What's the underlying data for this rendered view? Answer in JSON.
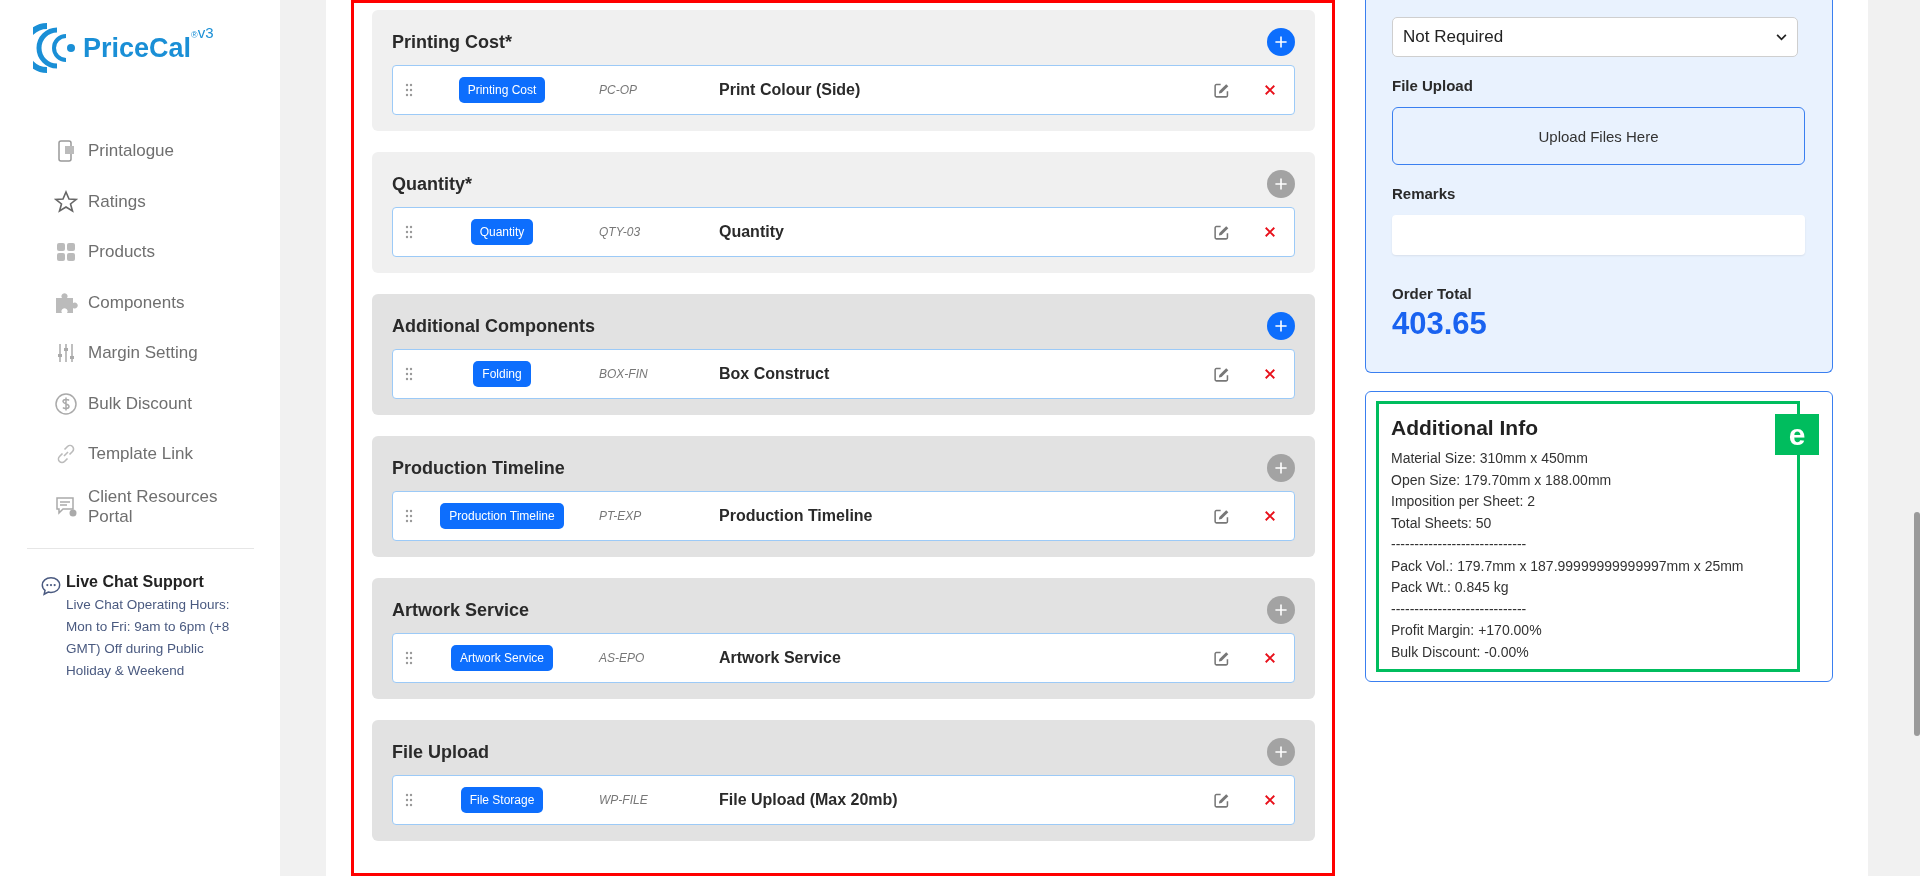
{
  "logo": {
    "name": "PriceCal",
    "mark": "®",
    "version": "v3"
  },
  "sidebar": {
    "items": [
      {
        "label": "Printalogue"
      },
      {
        "label": "Ratings"
      },
      {
        "label": "Products"
      },
      {
        "label": "Components"
      },
      {
        "label": "Margin Setting"
      },
      {
        "label": "Bulk Discount"
      },
      {
        "label": "Template Link"
      },
      {
        "label": "Client Resources Portal"
      }
    ],
    "support": {
      "title": "Live Chat Support",
      "text": "Live Chat Operating Hours: Mon to Fri: 9am to 6pm (+8 GMT) Off during Public Holiday & Weekend"
    }
  },
  "sections": [
    {
      "title": "Printing Cost*",
      "required": true,
      "add_disabled": false,
      "item": {
        "tag": "Printing Cost",
        "code": "PC-OP",
        "name": "Print Colour (Side)"
      }
    },
    {
      "title": "Quantity*",
      "required": true,
      "add_disabled": true,
      "item": {
        "tag": "Quantity",
        "code": "QTY-03",
        "name": "Quantity"
      }
    },
    {
      "title": "Additional Components",
      "required": false,
      "add_disabled": false,
      "item": {
        "tag": "Folding",
        "code": "BOX-FIN",
        "name": "Box Construct"
      }
    },
    {
      "title": "Production Timeline",
      "required": false,
      "add_disabled": true,
      "item": {
        "tag": "Production Timeline",
        "code": "PT-EXP",
        "name": "Production Timeline"
      }
    },
    {
      "title": "Artwork Service",
      "required": false,
      "add_disabled": true,
      "item": {
        "tag": "Artwork Service",
        "code": "AS-EPO",
        "name": "Artwork Service"
      }
    },
    {
      "title": "File Upload",
      "required": false,
      "add_disabled": true,
      "item": {
        "tag": "File Storage",
        "code": "WP-FILE",
        "name": "File Upload (Max 20mb)"
      }
    }
  ],
  "order_form": {
    "artwork_select": {
      "value": "Not Required"
    },
    "file_upload": {
      "label": "File Upload",
      "button": "Upload Files Here"
    },
    "remarks": {
      "label": "Remarks"
    },
    "order_total": {
      "label": "Order Total",
      "value": "403.65"
    }
  },
  "additional_info": {
    "title": "Additional Info",
    "lines": [
      "Material Size: 310mm x 450mm",
      "Open Size: 179.70mm x 188.00mm",
      "Imposition per Sheet: 2",
      "Total Sheets: 50",
      "-----------------------------",
      "Pack Vol.: 179.7mm x 187.99999999999997mm x 25mm",
      "Pack Wt.: 0.845 kg",
      "-----------------------------",
      "Profit Margin: +170.00%",
      "Bulk Discount: -0.00%"
    ]
  },
  "annotations": {
    "highlight_label": "e"
  }
}
